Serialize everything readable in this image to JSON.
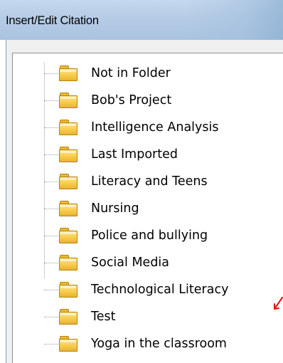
{
  "window": {
    "title": "Insert/Edit Citation"
  },
  "tree": {
    "items": [
      {
        "label": "Not in Folder"
      },
      {
        "label": "Bob's Project"
      },
      {
        "label": "Intelligence Analysis"
      },
      {
        "label": "Last Imported"
      },
      {
        "label": "Literacy and Teens"
      },
      {
        "label": "Nursing"
      },
      {
        "label": "Police and bullying"
      },
      {
        "label": "Social Media"
      },
      {
        "label": "Technological Literacy"
      },
      {
        "label": "Test"
      },
      {
        "label": "Yoga in the classroom"
      }
    ]
  },
  "icons": {
    "folder": "folder-icon",
    "annotation": "red-arrow-annotation"
  },
  "colors": {
    "title_bar": "#b7cde6",
    "folder_fill": "#f8cc4b",
    "folder_border": "#b58310",
    "tree_lines": "#a0a0a0",
    "annotation_arrow": "#e01010"
  }
}
